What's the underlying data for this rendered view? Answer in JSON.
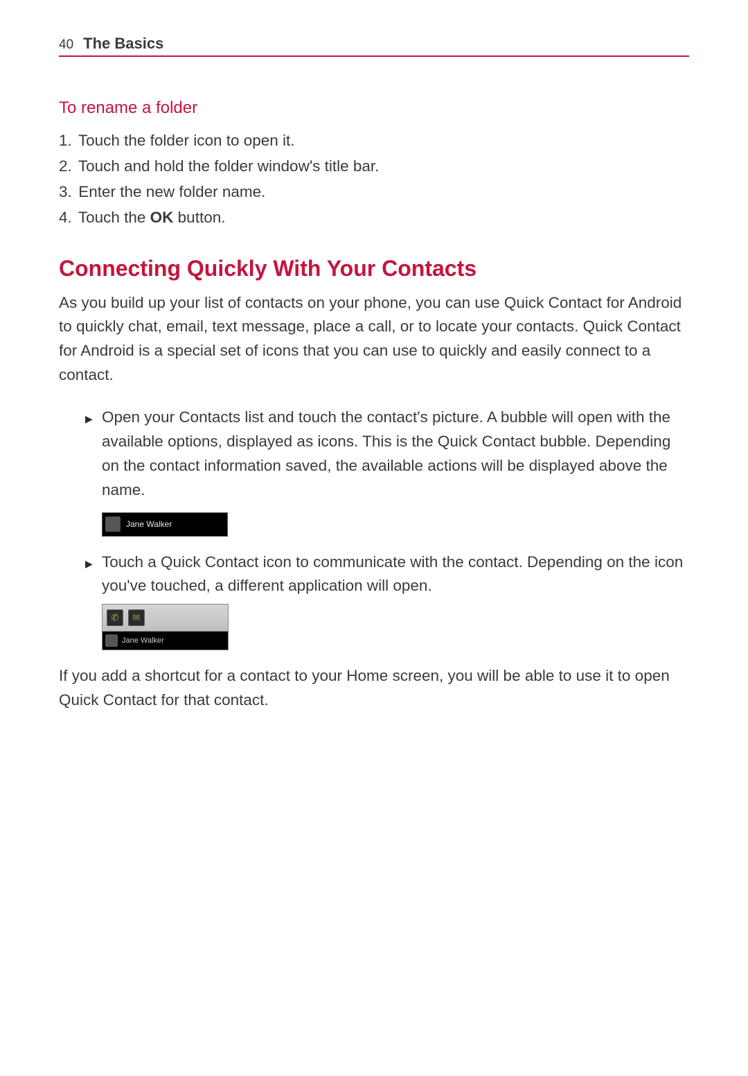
{
  "header": {
    "page_number": "40",
    "section": "The Basics"
  },
  "rename_folder": {
    "heading": "To rename a folder",
    "steps": [
      {
        "num": "1.",
        "text_a": " Touch the folder icon to open it."
      },
      {
        "num": "2.",
        "text_a": " Touch and hold the folder window's title bar."
      },
      {
        "num": "3.",
        "text_a": " Enter the new folder name."
      },
      {
        "num": "4.",
        "text_a": " Touch the ",
        "bold": "OK",
        "text_b": " button."
      }
    ]
  },
  "quick_contact": {
    "heading": "Connecting Quickly With Your Contacts",
    "intro": "As you build up your list of contacts on your phone, you can use Quick Contact for Android to quickly chat, email, text message, place a call, or to locate your contacts. Quick Contact for Android is a special set of icons that you can use to quickly and easily connect to a contact.",
    "bullets": [
      "Open your Contacts list and touch the contact's picture. A bubble will open with the available options, displayed as icons. This is the Quick Contact bubble. Depending on the contact information saved, the available actions will be displayed above the name.",
      "Touch a Quick Contact icon to communicate with the contact. Depending on the icon you've touched, a different application will open."
    ],
    "outro": "If you add a shortcut for a contact to your Home screen, you will be able to use it to open Quick Contact for that contact.",
    "example_contact_name": "Jane Walker"
  }
}
